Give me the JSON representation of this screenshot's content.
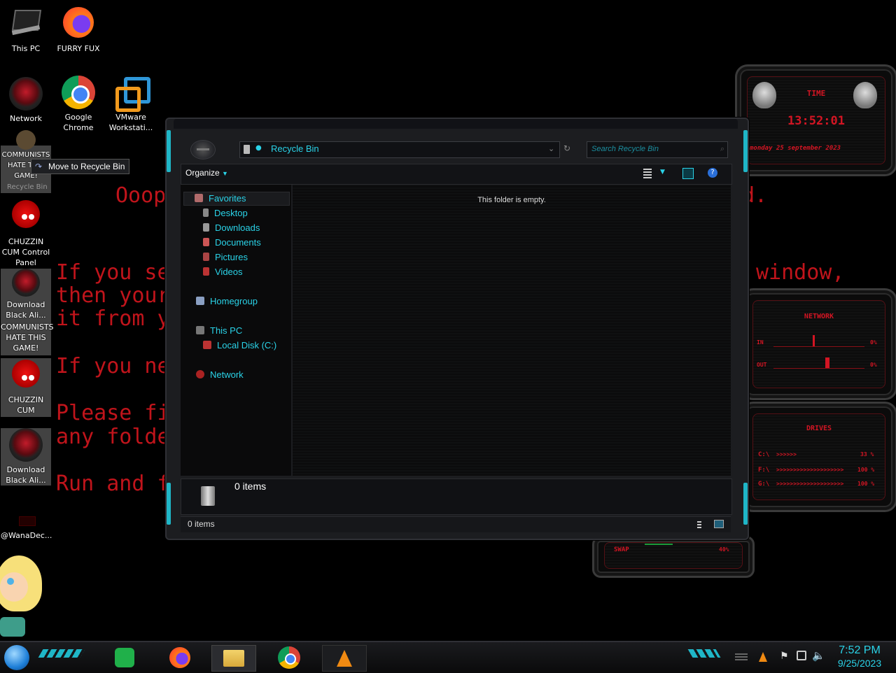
{
  "desktop": {
    "icons": [
      {
        "label": "This PC"
      },
      {
        "label": "FURRY FUX"
      },
      {
        "label": "Network"
      },
      {
        "label": "Google Chrome"
      },
      {
        "label": "VMware Workstati..."
      },
      {
        "label": "COMMUNISTS HATE THIS GAME!"
      },
      {
        "label": "Recycle Bin"
      },
      {
        "label": "CHUZZIN CUM Control Panel"
      },
      {
        "label": "Download Black Ali..."
      },
      {
        "label": "COMMUNISTS HATE THIS GAME!"
      },
      {
        "label": "CHUZZIN CUM"
      },
      {
        "label": "Download Black Ali..."
      },
      {
        "label": "@WanaDec..."
      }
    ],
    "drag_tooltip": "Move to Recycle Bin",
    "ransom_lines": [
      "Ooop",
      "d.",
      "If you se",
      "window,",
      "then your",
      "it from y",
      "If you ne",
      "Please fi",
      "any folde",
      "Run and f"
    ]
  },
  "widgets": {
    "clock": {
      "title": "TIME",
      "time": "13:52:01",
      "date": "monday 25 september 2023"
    },
    "network": {
      "title": "NETWORK",
      "in_label": "IN",
      "in_value": "0%",
      "out_label": "OUT",
      "out_value": "0%"
    },
    "drives": {
      "title": "DRIVES",
      "rows": [
        {
          "label": "C:\\",
          "bar": ">>>>>>",
          "value": "33 %"
        },
        {
          "label": "F:\\",
          "bar": ">>>>>>>>>>>>>>>>>>>>",
          "value": "100 %"
        },
        {
          "label": "G:\\",
          "bar": ">>>>>>>>>>>>>>>>>>>>",
          "value": "100 %"
        }
      ]
    },
    "swap": {
      "title": "SWAP",
      "value": "40%"
    }
  },
  "explorer": {
    "address": "Recycle Bin",
    "search_placeholder": "Search Recycle Bin",
    "organize": "Organize",
    "empty_message": "This folder is empty.",
    "nav": {
      "favorites": "Favorites",
      "items": [
        "Desktop",
        "Downloads",
        "Documents",
        "Pictures",
        "Videos"
      ],
      "homegroup": "Homegroup",
      "this_pc": "This PC",
      "local_disk": "Local Disk (C:)",
      "network": "Network"
    },
    "details_count": "0 items",
    "status_count": "0 items"
  },
  "taskbar": {
    "time": "7:52 PM",
    "date": "9/25/2023"
  },
  "colors": {
    "accent": "#1fb6c7",
    "ransom": "#c0141b",
    "widget_red": "#d31523"
  }
}
